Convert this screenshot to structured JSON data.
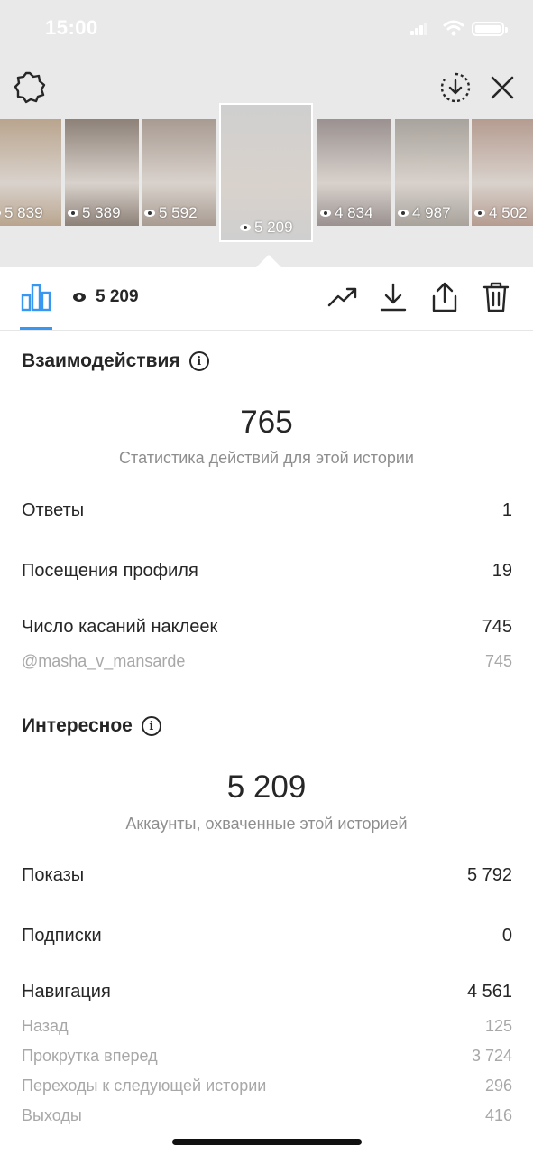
{
  "status_bar": {
    "time": "15:00"
  },
  "thumbnails": [
    {
      "views": "5 839",
      "color": "#b9a58e"
    },
    {
      "views": "5 389",
      "color": "#8d8178"
    },
    {
      "views": "5 592",
      "color": "#a89b92"
    },
    {
      "views": "5 209",
      "color": "#cfcfcf",
      "selected": true
    },
    {
      "views": "4 834",
      "color": "#9a9190"
    },
    {
      "views": "4 987",
      "color": "#a8a39c"
    },
    {
      "views": "4 502",
      "color": "#b59c91"
    }
  ],
  "toolbar": {
    "views": "5 209"
  },
  "interactions": {
    "title": "Взаимодействия",
    "total": "765",
    "caption": "Статистика действий для этой истории",
    "rows": [
      {
        "label": "Ответы",
        "value": "1"
      },
      {
        "label": "Посещения профиля",
        "value": "19"
      },
      {
        "label": "Число касаний наклеек",
        "value": "745"
      }
    ],
    "sticker": {
      "label": "@masha_v_mansarde",
      "value": "745"
    }
  },
  "discovery": {
    "title": "Интересное",
    "total": "5 209",
    "caption": "Аккаунты, охваченные этой историей",
    "rows": [
      {
        "label": "Показы",
        "value": "5 792"
      },
      {
        "label": "Подписки",
        "value": "0"
      },
      {
        "label": "Навигация",
        "value": "4 561"
      }
    ],
    "navigation": [
      {
        "label": "Назад",
        "value": "125"
      },
      {
        "label": "Прокрутка вперед",
        "value": "3 724"
      },
      {
        "label": "Переходы к следующей истории",
        "value": "296"
      },
      {
        "label": "Выходы",
        "value": "416"
      }
    ]
  },
  "colors": {
    "accent": "#3897f0",
    "text": "#262626",
    "muted": "#8e8e8e",
    "top_bg": "#e9e9e9"
  }
}
